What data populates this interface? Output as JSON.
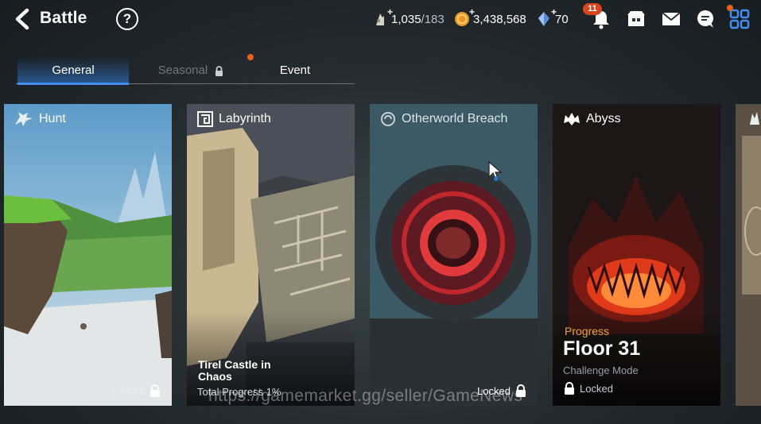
{
  "header": {
    "title": "Battle",
    "back_icon": "back-arrow-icon",
    "help_label": "?"
  },
  "resources": {
    "stamina_value": "1,035",
    "stamina_max": "/183",
    "gold_value": "3,438,568",
    "crystal_value": "70"
  },
  "notifications": {
    "count": "11"
  },
  "tabs": [
    {
      "label": "General"
    },
    {
      "label": "Seasonal"
    },
    {
      "label": "Event"
    }
  ],
  "cards": {
    "hunt": {
      "title": "Hunt",
      "status": "Locked"
    },
    "labyrinth": {
      "title": "Labyrinth",
      "subtitle": "Tirel Castle in Chaos",
      "progress": "Total Progress 1%"
    },
    "breach": {
      "title": "Otherworld Breach",
      "status": "Locked"
    },
    "abyss": {
      "title": "Abyss",
      "progress_label": "Progress",
      "floor": "Floor 31",
      "mode": "Challenge Mode",
      "mode_status": "Locked"
    }
  },
  "watermark": "https://gamemarket.gg/seller/GameNews",
  "colors": {
    "accent": "#3f8ef0",
    "badge": "#d9451a",
    "abyss_glow": "#e03a1a"
  }
}
